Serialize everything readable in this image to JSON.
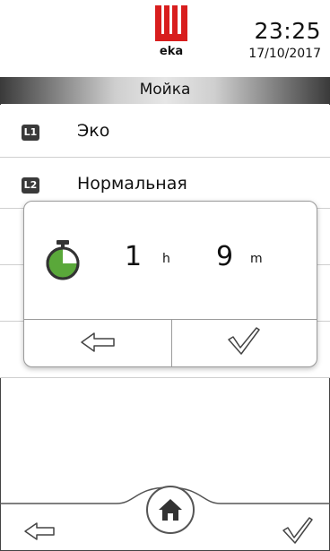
{
  "header": {
    "logo_text": "eka",
    "time": "23:25",
    "date": "17/10/2017"
  },
  "title": "Мойка",
  "programs": [
    {
      "badge": "L1",
      "label": "Эко"
    },
    {
      "badge": "L2",
      "label": "Нормальная"
    }
  ],
  "dialog": {
    "hours_value": "1",
    "hours_unit": "h",
    "minutes_value": "9",
    "minutes_unit": "m",
    "icon": "timer-icon"
  },
  "colors": {
    "brand_red": "#d81e1e",
    "timer_green": "#5aa83a",
    "badge_bg": "#3a3a3a"
  },
  "icons": {
    "back": "arrow-left-icon",
    "confirm": "checkmark-icon",
    "home": "home-icon"
  }
}
